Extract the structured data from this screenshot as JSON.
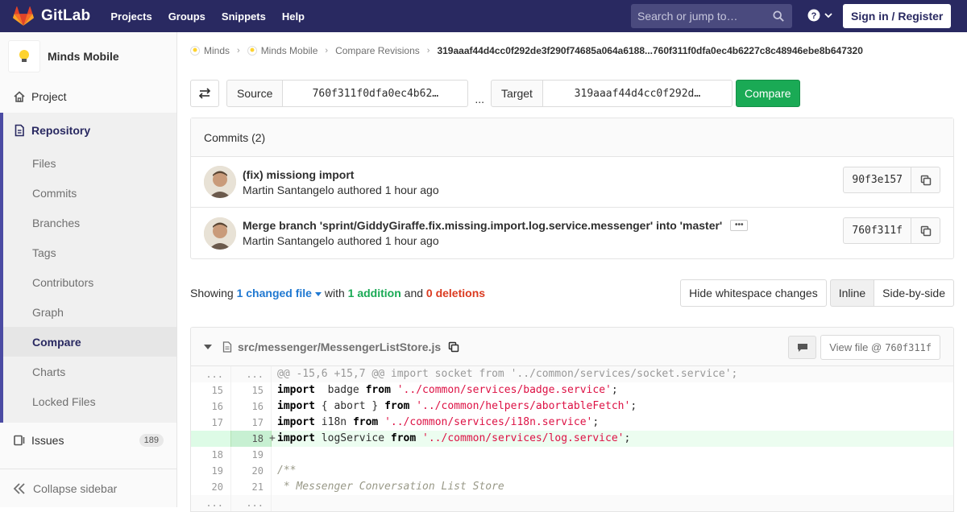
{
  "navbar": {
    "brand": "GitLab",
    "links": [
      "Projects",
      "Groups",
      "Snippets",
      "Help"
    ],
    "search_placeholder": "Search or jump to…",
    "help_icon": "question-circle-icon",
    "signin_label": "Sign in / Register"
  },
  "sidebar": {
    "project_name": "Minds Mobile",
    "project_label": "Project",
    "repository_label": "Repository",
    "repository_items": [
      "Files",
      "Commits",
      "Branches",
      "Tags",
      "Contributors",
      "Graph",
      "Compare",
      "Charts",
      "Locked Files"
    ],
    "active_item": "Compare",
    "issues_label": "Issues",
    "issues_count": "189",
    "collapse_label": "Collapse sidebar"
  },
  "breadcrumb": {
    "group": "Minds",
    "project": "Minds Mobile",
    "section": "Compare Revisions",
    "current": "319aaaf44d4cc0f292de3f290f74685a064a6188...760f311f0dfa0ec4b6227c8c48946ebe8b647320"
  },
  "compare": {
    "source_label": "Source",
    "source_value": "760f311f0dfa0ec4b62…",
    "dots": "...",
    "target_label": "Target",
    "target_value": "319aaaf44d4cc0f292d…",
    "button_label": "Compare"
  },
  "commits": {
    "header": "Commits (2)",
    "items": [
      {
        "title": "(fix) missiong import",
        "author": "Martin Santangelo",
        "meta_suffix": " authored 1 hour ago",
        "sha": "90f3e157"
      },
      {
        "title": "Merge branch 'sprint/GiddyGiraffe.fix.missing.import.log.service.messenger' into 'master'",
        "author": "Martin Santangelo",
        "meta_suffix": " authored 1 hour ago",
        "sha": "760f311f"
      }
    ]
  },
  "diff_stats": {
    "showing": "Showing",
    "changed_files": "1 changed file",
    "with": "with",
    "additions": "1 addition",
    "and": "and",
    "deletions": "0 deletions",
    "hide_whitespace": "Hide whitespace changes",
    "inline": "Inline",
    "side_by_side": "Side-by-side"
  },
  "file": {
    "path": "src/messenger/MessengerListStore.js",
    "view_file_label": "View file @",
    "view_file_sha": "760f311f",
    "lines": [
      {
        "type": "match",
        "old": "...",
        "new": "...",
        "text": "@@ -15,6 +15,7 @@ import socket from '../common/services/socket.service';"
      },
      {
        "type": "ctx",
        "old": "15",
        "new": "15",
        "parts": [
          [
            "kw",
            "import"
          ],
          [
            "",
            "  badge "
          ],
          [
            "kw",
            "from"
          ],
          [
            "",
            " "
          ],
          [
            "str",
            "'../common/services/badge.service'"
          ],
          [
            "",
            ";"
          ]
        ]
      },
      {
        "type": "ctx",
        "old": "16",
        "new": "16",
        "parts": [
          [
            "kw",
            "import"
          ],
          [
            "",
            " { abort } "
          ],
          [
            "kw",
            "from"
          ],
          [
            "",
            " "
          ],
          [
            "str",
            "'../common/helpers/abortableFetch'"
          ],
          [
            "",
            ";"
          ]
        ]
      },
      {
        "type": "ctx",
        "old": "17",
        "new": "17",
        "parts": [
          [
            "kw",
            "import"
          ],
          [
            "",
            " i18n "
          ],
          [
            "kw",
            "from"
          ],
          [
            "",
            " "
          ],
          [
            "str",
            "'../common/services/i18n.service'"
          ],
          [
            "",
            ";"
          ]
        ]
      },
      {
        "type": "add",
        "old": "",
        "new": "18",
        "parts": [
          [
            "kw",
            "import"
          ],
          [
            "",
            " logService "
          ],
          [
            "kw",
            "from"
          ],
          [
            "",
            " "
          ],
          [
            "str",
            "'../common/services/log.service'"
          ],
          [
            "",
            ";"
          ]
        ]
      },
      {
        "type": "ctx",
        "old": "18",
        "new": "19",
        "parts": [
          [
            "",
            ""
          ]
        ]
      },
      {
        "type": "ctx",
        "old": "19",
        "new": "20",
        "parts": [
          [
            "cmt",
            "/**"
          ]
        ]
      },
      {
        "type": "ctx",
        "old": "20",
        "new": "21",
        "parts": [
          [
            "cmt",
            " * Messenger Conversation List Store"
          ]
        ]
      },
      {
        "type": "match",
        "old": "...",
        "new": "...",
        "text": ""
      }
    ]
  },
  "colors": {
    "navbar": "#292961",
    "accent": "#4b4ba3",
    "compare_button": "#1aaa55",
    "link": "#1f78d1",
    "deletions": "#db3b21"
  }
}
